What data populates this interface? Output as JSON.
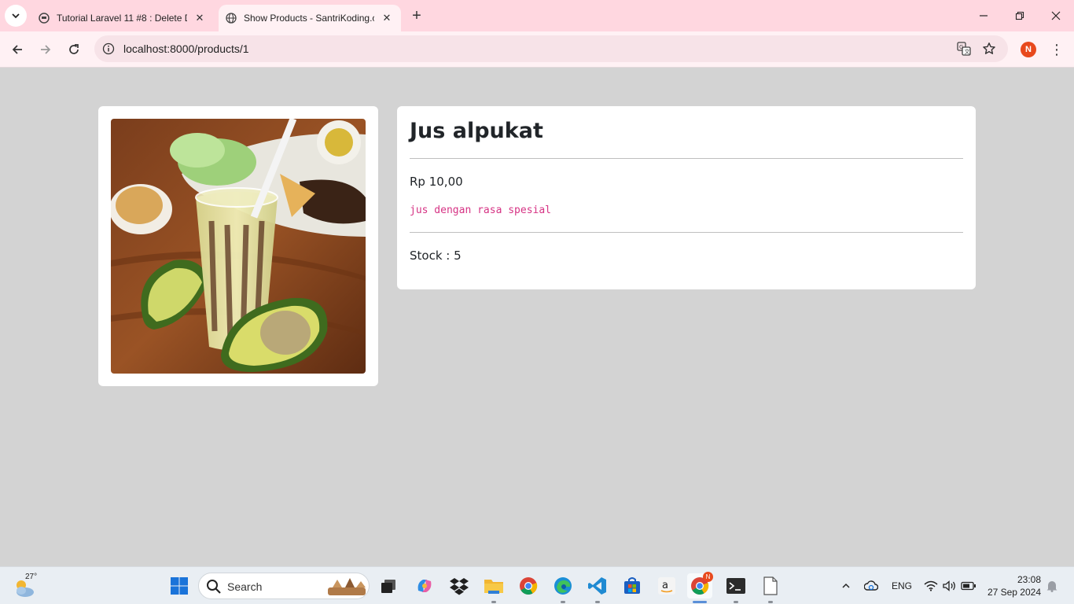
{
  "browser": {
    "tabs": [
      {
        "title": "Tutorial Laravel 11 #8 : Delete D",
        "active": false
      },
      {
        "title": "Show Products - SantriKoding.c",
        "active": true
      }
    ],
    "url": "localhost:8000/products/1"
  },
  "profile": {
    "initial": "N",
    "color": "#e8491d"
  },
  "product": {
    "image_alt": "Jus alpukat",
    "title": "Jus alpukat",
    "price": "Rp 10,00",
    "description": "jus dengan rasa spesial",
    "stock": "Stock : 5"
  },
  "taskbar": {
    "weather_temp": "27°",
    "search_placeholder": "Search",
    "language": "ENG",
    "time": "23:08",
    "date": "27 Sep 2024"
  },
  "colors": {
    "page_bg": "#d3d3d3",
    "description": "#d63384",
    "tab_strip": "#ffd7e0"
  }
}
